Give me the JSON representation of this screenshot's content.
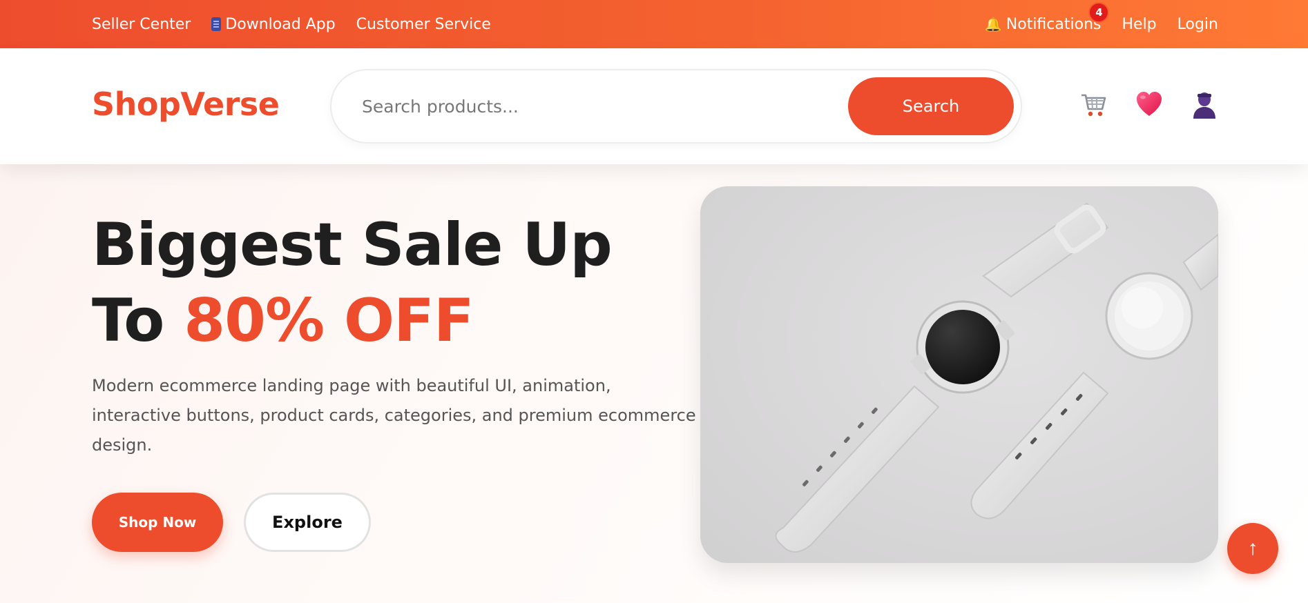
{
  "topbar": {
    "left_links": [
      {
        "label": "Seller Center",
        "icon": ""
      },
      {
        "label": "Download App",
        "icon": "phone-icon"
      },
      {
        "label": "Customer Service",
        "icon": ""
      }
    ],
    "notifications": {
      "label": "Notifications",
      "icon": "bell-icon",
      "count": "4"
    },
    "help": "Help",
    "login": "Login"
  },
  "header": {
    "logo": "ShopVerse",
    "search": {
      "placeholder": "Search products...",
      "value": "",
      "button": "Search"
    },
    "icons": [
      "cart-icon",
      "heart-icon",
      "user-icon"
    ]
  },
  "hero": {
    "title_line1": "Biggest Sale Up",
    "title_line2_prefix": "To ",
    "title_line2_accent": "80% OFF",
    "description": "Modern ecommerce landing page with beautiful UI, animation, interactive buttons, product cards, categories, and premium ecommerce design.",
    "primary_button": "Shop Now",
    "secondary_button": "Explore",
    "image": "white smartwatches on grey background"
  },
  "scroll_top": {
    "label": "↑"
  },
  "colors": {
    "accent": "#ee4d2d",
    "topbar_end": "#ff7a35",
    "text_dark": "#1f1f1f"
  }
}
